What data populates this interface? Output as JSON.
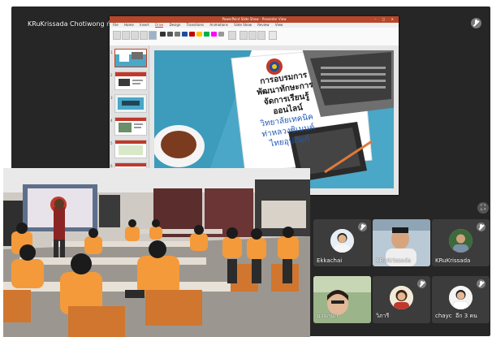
{
  "meeting": {
    "presenter_label": "KRuKrissada Chotiwong กำลังนำเสนอ",
    "more_participants": "อีก 3 คน"
  },
  "ppt": {
    "window_title": "PowerPoint Slide Show - Presenter View",
    "tabs": [
      "File",
      "Home",
      "Insert",
      "Draw",
      "Design",
      "Transitions",
      "Animations",
      "Slide Show",
      "Review",
      "View"
    ],
    "active_tab": "Draw"
  },
  "slide": {
    "title_lines": [
      "การอบรมการ",
      "พัฒนาทักษะการ",
      "จัดการเรียนรู้",
      "ออนไลน์"
    ],
    "subtitle_lines": [
      "วิทยาลัยเทคนิค",
      "ท่าหลวงซิเมนต์",
      "ไทยอุปถัมภ์"
    ]
  },
  "participants": [
    {
      "name": "Ekkachai",
      "muted": true
    },
    {
      "name": "KRuKrissada",
      "muted": true
    },
    {
      "name": "KRuKrissada",
      "muted": true
    },
    {
      "name": "นายกนก",
      "muted": true
    },
    {
      "name": "วิภารี",
      "muted": true
    },
    {
      "name": "chayc",
      "muted": true
    }
  ],
  "colors": {
    "meeting_bg": "#262626",
    "tile_bg": "#3c3c3c",
    "ppt_accent": "#b7472a",
    "slide_teal": "#4aa7c7",
    "student_shirt": "#f49a3a"
  }
}
